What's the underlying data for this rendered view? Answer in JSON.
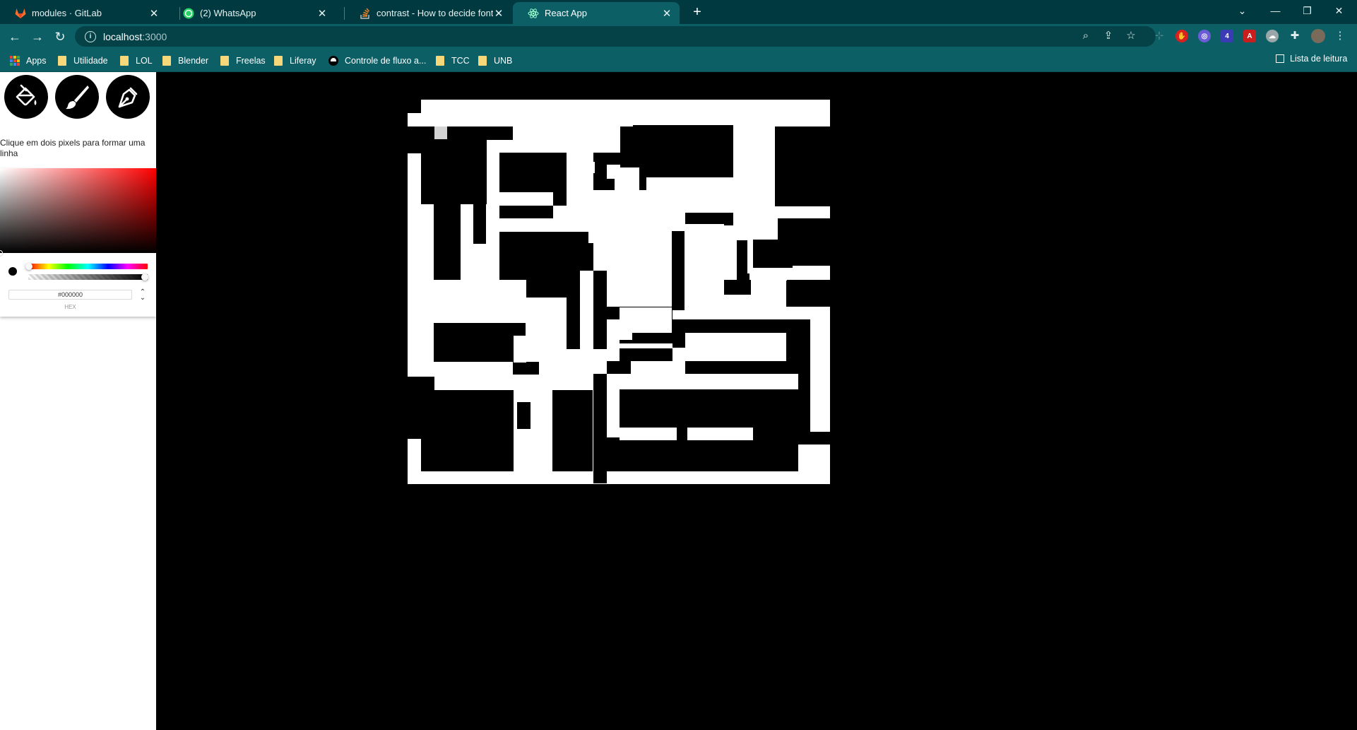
{
  "browser": {
    "tabs": [
      {
        "title": "modules · GitLab",
        "favicon": "gitlab-icon"
      },
      {
        "title": "(2) WhatsApp",
        "favicon": "whatsapp-icon"
      },
      {
        "title": "contrast - How to decide font co",
        "favicon": "stackoverflow-icon"
      },
      {
        "title": "React App",
        "favicon": "react-icon",
        "active": true
      }
    ],
    "address": {
      "host": "localhost",
      "port": ":3000"
    },
    "bookmarks": [
      {
        "label": "Apps",
        "icon": "apps-icon"
      },
      {
        "label": "Utilidade",
        "icon": "folder-icon"
      },
      {
        "label": "LOL",
        "icon": "folder-icon"
      },
      {
        "label": "Blender",
        "icon": "folder-icon"
      },
      {
        "label": "Freelas",
        "icon": "folder-icon"
      },
      {
        "label": "Liferay",
        "icon": "folder-icon"
      },
      {
        "label": "Controle de fluxo a...",
        "icon": "site-icon"
      },
      {
        "label": "TCC",
        "icon": "folder-icon"
      },
      {
        "label": "UNB",
        "icon": "folder-icon"
      }
    ],
    "reading_list": "Lista de leitura",
    "extension_badge": "4"
  },
  "app": {
    "tools": [
      {
        "name": "fill-bucket-tool",
        "icon": "paint-bucket-icon"
      },
      {
        "name": "brush-tool",
        "icon": "brush-icon"
      },
      {
        "name": "pen-line-tool",
        "icon": "pen-nib-icon"
      }
    ],
    "hint": "Clique em dois pixels para formar uma linha",
    "color_picker": {
      "hue_color": "#ff0000",
      "selected_color": "#000000",
      "hex_value": "#000000",
      "hex_label": "hex",
      "alpha": 1
    },
    "canvas": {
      "background": "#000000",
      "wall_color": "#ffffff",
      "highlight_color": "#d4d4d4"
    }
  }
}
